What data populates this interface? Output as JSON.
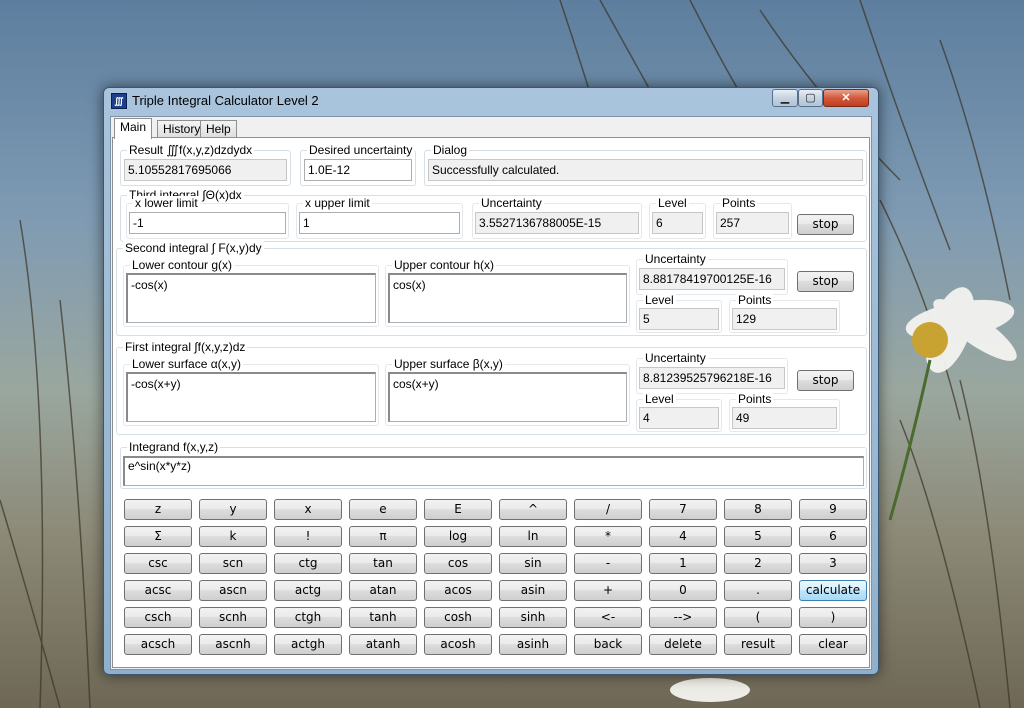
{
  "window": {
    "title": "Triple Integral Calculator Level 2",
    "icon": "app-icon"
  },
  "controls": {
    "minimize": "▁",
    "maximize": "▢",
    "close": "✕"
  },
  "tabs": [
    "Main",
    "History",
    "Help"
  ],
  "result": {
    "label": "Result ∭f(x,y,z)dzdydx",
    "value": "5.10552817695066"
  },
  "desired_uncertainty": {
    "label": "Desired uncertainty",
    "value": "1.0E-12"
  },
  "dialog": {
    "label": "Dialog",
    "value": "Successfully calculated."
  },
  "third": {
    "label": "Third integral  ∫Θ(x)dx",
    "lower_label": "x lower limit",
    "lower": "-1",
    "upper_label": "x upper limit",
    "upper": "1",
    "uncertainty_label": "Uncertainty",
    "uncertainty": "3.5527136788005E-15",
    "level_label": "Level",
    "level": "6",
    "points_label": "Points",
    "points": "257",
    "stop": "stop"
  },
  "second": {
    "label": "Second integral  ∫ F(x,y)dy",
    "lower_label": "Lower contour g(x)",
    "lower": "-cos(x)",
    "upper_label": "Upper contour h(x)",
    "upper": "cos(x)",
    "uncertainty_label": "Uncertainty",
    "uncertainty": "8.88178419700125E-16",
    "level_label": "Level",
    "level": "5",
    "points_label": "Points",
    "points": "129",
    "stop": "stop"
  },
  "first": {
    "label": "First integral  ∫f(x,y,z)dz",
    "lower_label": "Lower surface α(x,y)",
    "lower": "-cos(x+y)",
    "upper_label": "Upper surface β(x,y)",
    "upper": "cos(x+y)",
    "uncertainty_label": "Uncertainty",
    "uncertainty": "8.81239525796218E-16",
    "level_label": "Level",
    "level": "4",
    "points_label": "Points",
    "points": "49",
    "stop": "stop"
  },
  "integrand": {
    "label": "Integrand f(x,y,z)",
    "value": "e^sin(x*y*z)"
  },
  "keypad": [
    [
      "z",
      "y",
      "x",
      "e",
      "E",
      "^",
      "/",
      "7",
      "8",
      "9"
    ],
    [
      "Σ",
      "k",
      "!",
      "π",
      "log",
      "ln",
      "*",
      "4",
      "5",
      "6"
    ],
    [
      "csc",
      "scn",
      "ctg",
      "tan",
      "cos",
      "sin",
      "-",
      "1",
      "2",
      "3"
    ],
    [
      "acsc",
      "ascn",
      "actg",
      "atan",
      "acos",
      "asin",
      "+",
      "0",
      ".",
      "calculate"
    ],
    [
      "csch",
      "scnh",
      "ctgh",
      "tanh",
      "cosh",
      "sinh",
      "<-",
      "-->",
      "(",
      ")"
    ],
    [
      "acsch",
      "ascnh",
      "actgh",
      "atanh",
      "acosh",
      "asinh",
      "back",
      "delete",
      "result",
      "clear"
    ]
  ]
}
